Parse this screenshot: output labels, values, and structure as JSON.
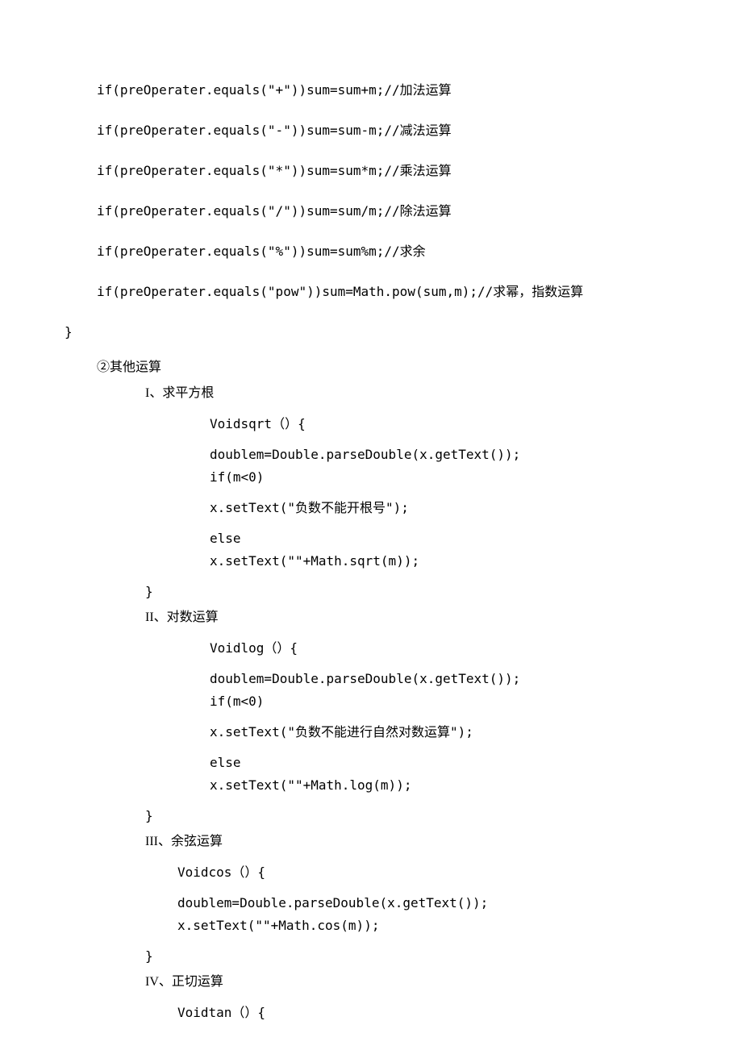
{
  "arithmetic": {
    "lines": [
      "if(preOperater.equals(\"+\"))sum=sum+m;//加法运算",
      "if(preOperater.equals(\"-\"))sum=sum-m;//减法运算",
      "if(preOperater.equals(\"*\"))sum=sum*m;//乘法运算",
      "if(preOperater.equals(\"/\"))sum=sum/m;//除法运算",
      "if(preOperater.equals(\"%\"))sum=sum%m;//求余",
      "if(preOperater.equals(\"pow\"))sum=Math.pow(sum,m);//求幂，指数运算"
    ],
    "close": "}"
  },
  "other_heading": "②其他运算",
  "sqrt": {
    "title": "I、求平方根",
    "lines": [
      "Voidsqrt（）{",
      "doublem=Double.parseDouble(x.getText());",
      "if(m<0)",
      "x.setText(\"负数不能开根号\");",
      "else",
      "x.setText(\"\"+Math.sqrt(m));"
    ],
    "close": "}"
  },
  "log": {
    "title": "II、对数运算",
    "lines": [
      "Voidlog（）{",
      "doublem=Double.parseDouble(x.getText());",
      "if(m<0)",
      "x.setText(\"负数不能进行自然对数运算\");",
      "else",
      "x.setText(\"\"+Math.log(m));"
    ],
    "close": "}"
  },
  "cos": {
    "title": "III、余弦运算",
    "lines": [
      "Voidcos（）{",
      "doublem=Double.parseDouble(x.getText());",
      "x.setText(\"\"+Math.cos(m));"
    ],
    "close": "}"
  },
  "tan": {
    "title": "IV、正切运算",
    "lines": [
      "Voidtan（）{"
    ]
  }
}
